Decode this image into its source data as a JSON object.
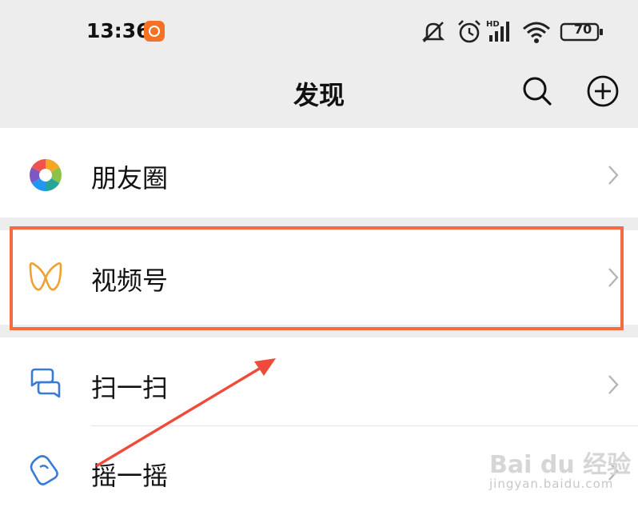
{
  "status": {
    "time": "13:36",
    "battery": "70",
    "network": "HD"
  },
  "header": {
    "title": "发现"
  },
  "menu": [
    {
      "label": "朋友圈",
      "icon": "moments-icon"
    },
    {
      "label": "视频号",
      "icon": "channels-icon"
    },
    {
      "label": "扫一扫",
      "icon": "scan-icon"
    },
    {
      "label": "摇一摇",
      "icon": "shake-icon"
    }
  ],
  "watermark": {
    "logo": "Bai du 经验",
    "url": "jingyan.baidu.com"
  },
  "colors": {
    "background": "#ededed",
    "highlight": "#f26b43",
    "channels_icon": "#f0a030",
    "scan_icon": "#3a7bd5"
  }
}
